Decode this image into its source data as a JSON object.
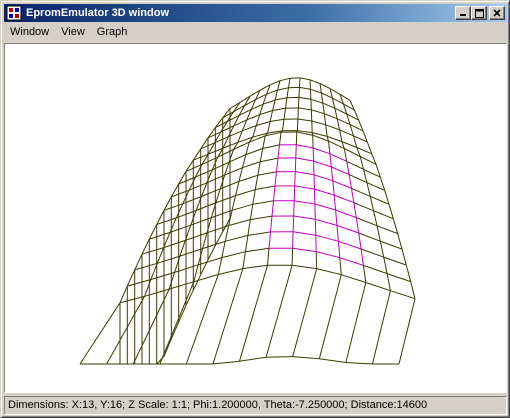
{
  "window": {
    "title": "EpromEmulator 3D window",
    "icon": "app-icon"
  },
  "titlebar_buttons": {
    "minimize_icon": "minimize-icon",
    "maximize_icon": "maximize-icon",
    "close_icon": "close-icon"
  },
  "menu": {
    "items": [
      {
        "label": "Window"
      },
      {
        "label": "View"
      },
      {
        "label": "Graph"
      }
    ]
  },
  "graph": {
    "wire_color": "#3a3a00",
    "highlight_color": "#c000c0",
    "background": "#ffffff"
  },
  "status": {
    "text": "Dimensions: X:13, Y:16; Z Scale: 1:1; Phi:1.200000, Theta:-7.250000; Distance:14600"
  }
}
